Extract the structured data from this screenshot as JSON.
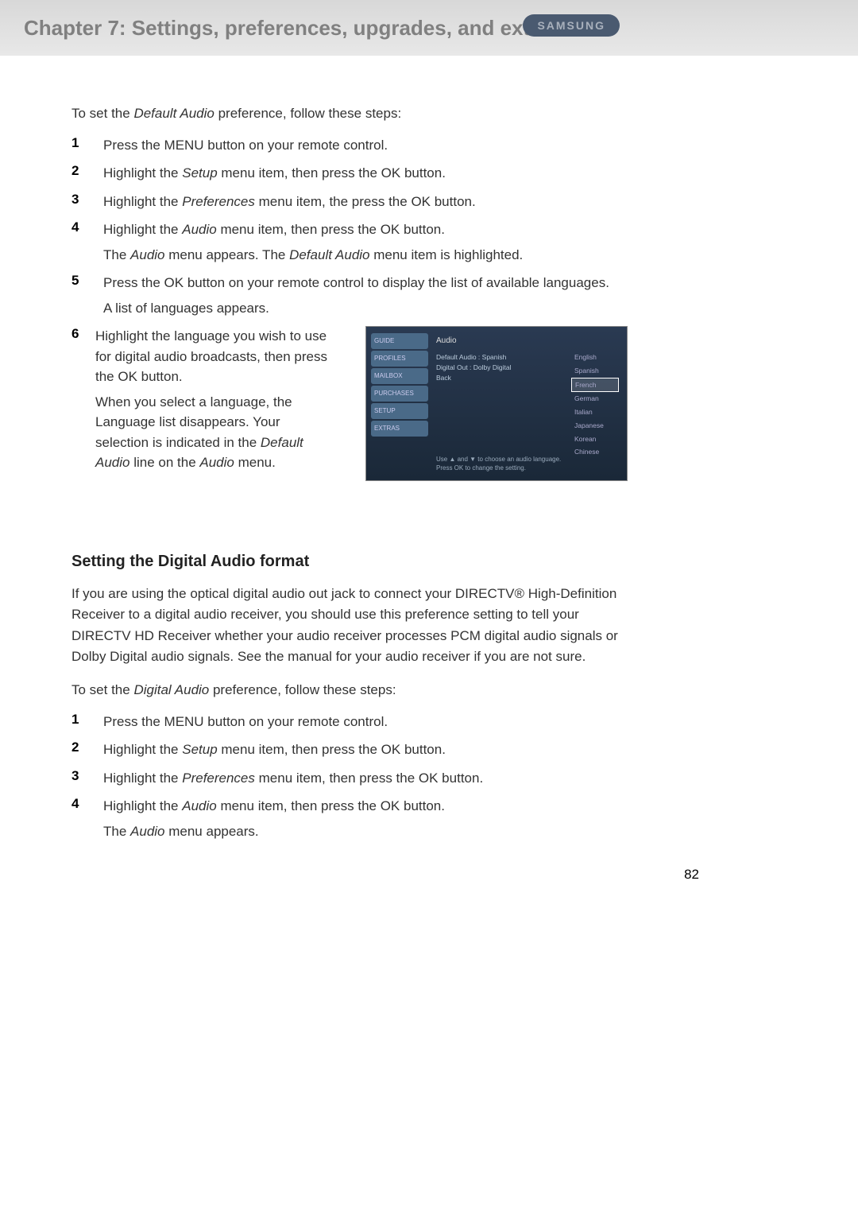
{
  "header": {
    "chapter_title": "Chapter 7: Settings, preferences, upgrades, and extras",
    "brand": "SAMSUNG"
  },
  "section1": {
    "intro_pre": "To set the ",
    "intro_em": "Default Audio",
    "intro_post": " preference, follow these steps:",
    "steps": [
      {
        "n": "1",
        "text": "Press the MENU button on your remote control."
      },
      {
        "n": "2",
        "pre": "Highlight the ",
        "em": "Setup",
        "post": " menu item, then press the OK button."
      },
      {
        "n": "3",
        "pre": "Highlight the ",
        "em": "Preferences",
        "post": " menu item, the press the OK button."
      },
      {
        "n": "4",
        "pre": "Highlight the ",
        "em": "Audio",
        "post": " menu item, then press the OK button.",
        "sub_pre": "The ",
        "sub_em1": "Audio",
        "sub_mid": " menu appears. The ",
        "sub_em2": "Default Audio",
        "sub_post": " menu item is highlighted."
      },
      {
        "n": "5",
        "text": "Press the OK button on your remote control to display the list of available languages.",
        "sub": "A list of languages appears."
      },
      {
        "n": "6",
        "text": "Highlight the language you wish to use for digital audio broadcasts, then press the OK button.",
        "sub_pre": "When you select a language, the Language list disappears. Your selection is indicated in the ",
        "sub_em1": "Default Audio",
        "sub_mid": " line on the ",
        "sub_em2": "Audio",
        "sub_post": " menu."
      }
    ]
  },
  "screenshot": {
    "sidebar": [
      "GUIDE",
      "PROFILES",
      "MAILBOX",
      "PURCHASES",
      "SETUP",
      "EXTRAS"
    ],
    "panel_title": "Audio",
    "main_lines": [
      "Default Audio : Spanish",
      "Digital Out : Dolby Digital",
      "Back"
    ],
    "languages": [
      "English",
      "Spanish",
      "French",
      "German",
      "Italian",
      "Japanese",
      "Korean",
      "Chinese"
    ],
    "selected_language": "French",
    "footer_line1": "Use ▲ and ▼ to choose an audio language.",
    "footer_line2": "Press OK to change the setting."
  },
  "section2": {
    "heading": "Setting the Digital Audio format",
    "para1": "If you are using the optical digital audio out jack to connect your DIRECTV® High-Definition Receiver to a digital audio receiver, you should use this preference setting to tell your DIRECTV HD Receiver whether your audio receiver processes PCM digital audio signals or Dolby Digital audio signals. See the manual for your audio receiver if you are not sure.",
    "intro_pre": "To set the ",
    "intro_em": "Digital Audio",
    "intro_post": " preference, follow these steps:",
    "steps": [
      {
        "n": "1",
        "text": "Press the MENU button on your remote control."
      },
      {
        "n": "2",
        "pre": "Highlight the ",
        "em": "Setup",
        "post": " menu item, then press the OK button."
      },
      {
        "n": "3",
        "pre": "Highlight the ",
        "em": "Preferences",
        "post": " menu item, then press the OK button."
      },
      {
        "n": "4",
        "pre": "Highlight the ",
        "em": "Audio",
        "post": " menu item, then press the OK button.",
        "sub_pre": "The ",
        "sub_em1": "Audio",
        "sub_post": " menu appears."
      }
    ]
  },
  "page_number": "82"
}
